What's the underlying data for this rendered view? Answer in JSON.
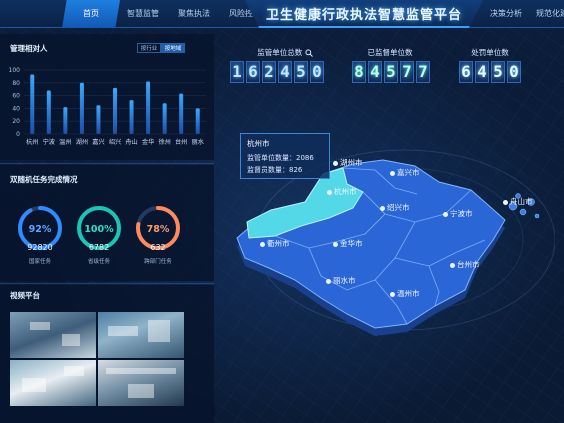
{
  "header": {
    "title": "卫生健康行政执法智慧监管平台",
    "nav_left": [
      "首页",
      "智慧监管",
      "聚焦执法",
      "风险控制"
    ],
    "nav_right": [
      "决策分析",
      "规范化建"
    ]
  },
  "panel_manage": {
    "title": "管理相对人",
    "tabs": [
      "按行业",
      "按地域"
    ],
    "active_tab": "按地域"
  },
  "chart_data": {
    "type": "bar",
    "categories": [
      "杭州",
      "宁波",
      "温州",
      "湖州",
      "嘉兴",
      "绍兴",
      "舟山",
      "金华",
      "徐州",
      "台州",
      "丽水"
    ],
    "values": [
      93,
      68,
      42,
      80,
      45,
      72,
      53,
      82,
      48,
      63,
      40
    ],
    "yticks": [
      0,
      20,
      40,
      60,
      80,
      100
    ],
    "ylim": [
      0,
      100
    ],
    "xlabel": "",
    "ylabel": "",
    "colors": {
      "bar_top": "#39a9ff",
      "bar_bottom": "#1c4fa8"
    }
  },
  "panel_tasks": {
    "title": "双随机任务完成情况",
    "rings": [
      {
        "percent": "92%",
        "value": "92820",
        "caption": "国家任务",
        "fraction": 0.92,
        "color": "#2f8cff"
      },
      {
        "percent": "100%",
        "value": "6782",
        "caption": "省级任务",
        "fraction": 1.0,
        "color": "#17c7b3"
      },
      {
        "percent": "78%",
        "value": "632",
        "caption": "跨部门任务",
        "fraction": 0.78,
        "color": "#ff8a5c"
      }
    ]
  },
  "panel_video": {
    "title": "视频平台"
  },
  "stats": [
    {
      "label": "监管单位总数",
      "digits": [
        "1",
        "6",
        "2",
        "4",
        "5",
        "0"
      ],
      "has_search": true,
      "style": "blue"
    },
    {
      "label": "已监督单位数",
      "digits": [
        "8",
        "4",
        "5",
        "7",
        "7"
      ],
      "has_search": false,
      "style": "cyan"
    },
    {
      "label": "处罚单位数",
      "digits": [
        "6",
        "4",
        "5",
        "0"
      ],
      "has_search": false,
      "style": "mint"
    }
  ],
  "tooltip": {
    "city": "杭州市",
    "row1_label": "监管单位数量：",
    "row1_value": "2086",
    "row2_label": "监督员数量：",
    "row2_value": "826"
  },
  "map": {
    "cities": [
      "湖州市",
      "嘉兴市",
      "杭州市",
      "绍兴市",
      "宁波市",
      "舟山市",
      "衢州市",
      "金华市",
      "台州市",
      "丽水市",
      "温州市"
    ],
    "colors": {
      "base": "#2a66d6",
      "highlight": "#53d8e8",
      "edge": "#7fb6ff"
    }
  }
}
